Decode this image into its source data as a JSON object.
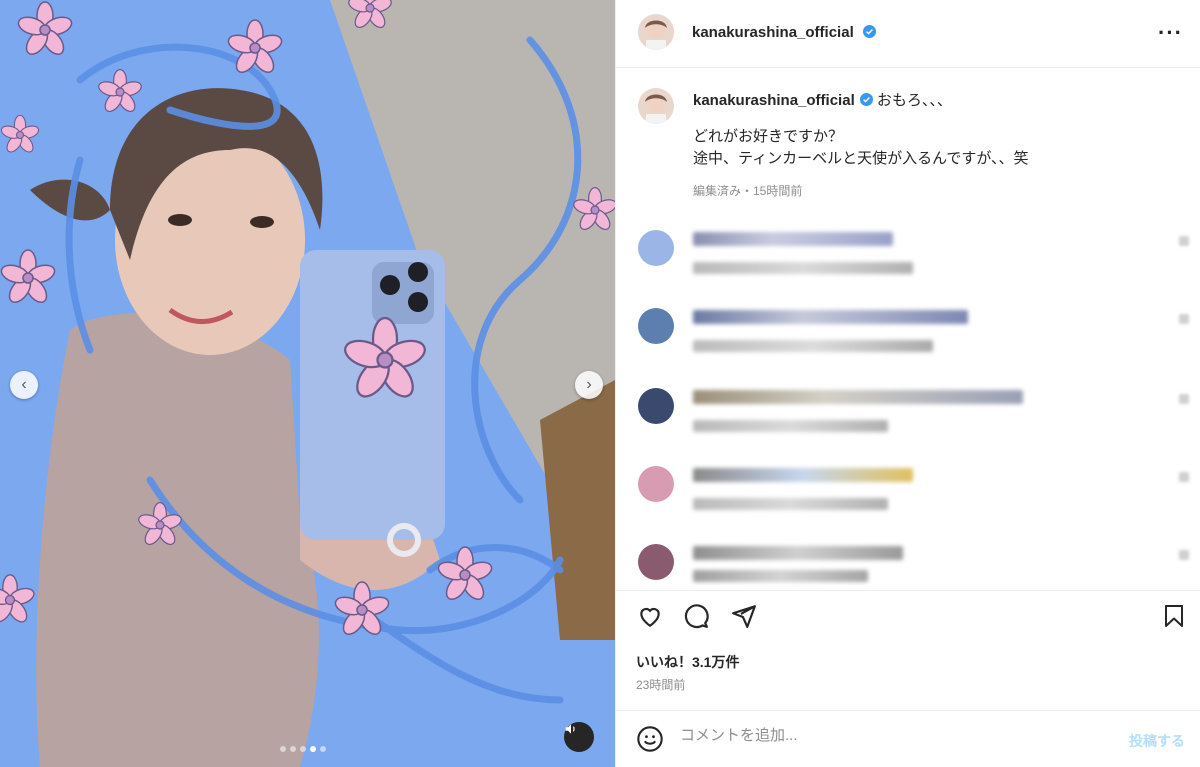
{
  "post": {
    "username": "kanakurashina_official",
    "caption_lines": [
      "おもろ、、、",
      "どれがお好きですか？",
      "途中、ティンカーベルと天使が入るんですが、、笑"
    ],
    "edited_meta": "編集済み・15時間前",
    "likes": "いいね！3.1万件",
    "time": "23時間前"
  },
  "carousel": {
    "prev_icon": "chevron-left-icon",
    "next_icon": "chevron-right-icon",
    "dot_count": 5,
    "active_dot": 3
  },
  "comment_bar": {
    "placeholder": "コメントを追加...",
    "post_label": "投稿する"
  },
  "colors": {
    "verified": "#3897f0",
    "post_button": "#b2dffc",
    "media_bg": "#7aa9f0"
  }
}
